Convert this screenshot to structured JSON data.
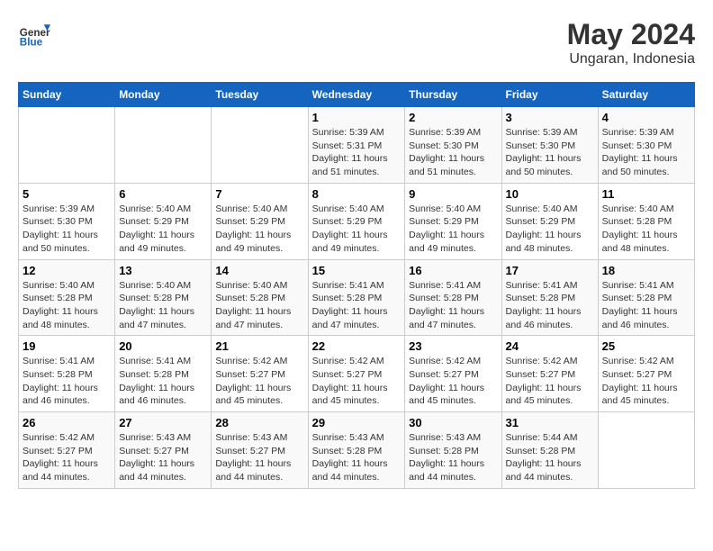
{
  "logo": {
    "general": "General",
    "blue": "Blue"
  },
  "title": "May 2024",
  "subtitle": "Ungaran, Indonesia",
  "days_of_week": [
    "Sunday",
    "Monday",
    "Tuesday",
    "Wednesday",
    "Thursday",
    "Friday",
    "Saturday"
  ],
  "weeks": [
    [
      {
        "day": "",
        "info": ""
      },
      {
        "day": "",
        "info": ""
      },
      {
        "day": "",
        "info": ""
      },
      {
        "day": "1",
        "info": "Sunrise: 5:39 AM\nSunset: 5:31 PM\nDaylight: 11 hours\nand 51 minutes."
      },
      {
        "day": "2",
        "info": "Sunrise: 5:39 AM\nSunset: 5:30 PM\nDaylight: 11 hours\nand 51 minutes."
      },
      {
        "day": "3",
        "info": "Sunrise: 5:39 AM\nSunset: 5:30 PM\nDaylight: 11 hours\nand 50 minutes."
      },
      {
        "day": "4",
        "info": "Sunrise: 5:39 AM\nSunset: 5:30 PM\nDaylight: 11 hours\nand 50 minutes."
      }
    ],
    [
      {
        "day": "5",
        "info": "Sunrise: 5:39 AM\nSunset: 5:30 PM\nDaylight: 11 hours\nand 50 minutes."
      },
      {
        "day": "6",
        "info": "Sunrise: 5:40 AM\nSunset: 5:29 PM\nDaylight: 11 hours\nand 49 minutes."
      },
      {
        "day": "7",
        "info": "Sunrise: 5:40 AM\nSunset: 5:29 PM\nDaylight: 11 hours\nand 49 minutes."
      },
      {
        "day": "8",
        "info": "Sunrise: 5:40 AM\nSunset: 5:29 PM\nDaylight: 11 hours\nand 49 minutes."
      },
      {
        "day": "9",
        "info": "Sunrise: 5:40 AM\nSunset: 5:29 PM\nDaylight: 11 hours\nand 49 minutes."
      },
      {
        "day": "10",
        "info": "Sunrise: 5:40 AM\nSunset: 5:29 PM\nDaylight: 11 hours\nand 48 minutes."
      },
      {
        "day": "11",
        "info": "Sunrise: 5:40 AM\nSunset: 5:28 PM\nDaylight: 11 hours\nand 48 minutes."
      }
    ],
    [
      {
        "day": "12",
        "info": "Sunrise: 5:40 AM\nSunset: 5:28 PM\nDaylight: 11 hours\nand 48 minutes."
      },
      {
        "day": "13",
        "info": "Sunrise: 5:40 AM\nSunset: 5:28 PM\nDaylight: 11 hours\nand 47 minutes."
      },
      {
        "day": "14",
        "info": "Sunrise: 5:40 AM\nSunset: 5:28 PM\nDaylight: 11 hours\nand 47 minutes."
      },
      {
        "day": "15",
        "info": "Sunrise: 5:41 AM\nSunset: 5:28 PM\nDaylight: 11 hours\nand 47 minutes."
      },
      {
        "day": "16",
        "info": "Sunrise: 5:41 AM\nSunset: 5:28 PM\nDaylight: 11 hours\nand 47 minutes."
      },
      {
        "day": "17",
        "info": "Sunrise: 5:41 AM\nSunset: 5:28 PM\nDaylight: 11 hours\nand 46 minutes."
      },
      {
        "day": "18",
        "info": "Sunrise: 5:41 AM\nSunset: 5:28 PM\nDaylight: 11 hours\nand 46 minutes."
      }
    ],
    [
      {
        "day": "19",
        "info": "Sunrise: 5:41 AM\nSunset: 5:28 PM\nDaylight: 11 hours\nand 46 minutes."
      },
      {
        "day": "20",
        "info": "Sunrise: 5:41 AM\nSunset: 5:28 PM\nDaylight: 11 hours\nand 46 minutes."
      },
      {
        "day": "21",
        "info": "Sunrise: 5:42 AM\nSunset: 5:27 PM\nDaylight: 11 hours\nand 45 minutes."
      },
      {
        "day": "22",
        "info": "Sunrise: 5:42 AM\nSunset: 5:27 PM\nDaylight: 11 hours\nand 45 minutes."
      },
      {
        "day": "23",
        "info": "Sunrise: 5:42 AM\nSunset: 5:27 PM\nDaylight: 11 hours\nand 45 minutes."
      },
      {
        "day": "24",
        "info": "Sunrise: 5:42 AM\nSunset: 5:27 PM\nDaylight: 11 hours\nand 45 minutes."
      },
      {
        "day": "25",
        "info": "Sunrise: 5:42 AM\nSunset: 5:27 PM\nDaylight: 11 hours\nand 45 minutes."
      }
    ],
    [
      {
        "day": "26",
        "info": "Sunrise: 5:42 AM\nSunset: 5:27 PM\nDaylight: 11 hours\nand 44 minutes."
      },
      {
        "day": "27",
        "info": "Sunrise: 5:43 AM\nSunset: 5:27 PM\nDaylight: 11 hours\nand 44 minutes."
      },
      {
        "day": "28",
        "info": "Sunrise: 5:43 AM\nSunset: 5:27 PM\nDaylight: 11 hours\nand 44 minutes."
      },
      {
        "day": "29",
        "info": "Sunrise: 5:43 AM\nSunset: 5:28 PM\nDaylight: 11 hours\nand 44 minutes."
      },
      {
        "day": "30",
        "info": "Sunrise: 5:43 AM\nSunset: 5:28 PM\nDaylight: 11 hours\nand 44 minutes."
      },
      {
        "day": "31",
        "info": "Sunrise: 5:44 AM\nSunset: 5:28 PM\nDaylight: 11 hours\nand 44 minutes."
      },
      {
        "day": "",
        "info": ""
      }
    ]
  ]
}
